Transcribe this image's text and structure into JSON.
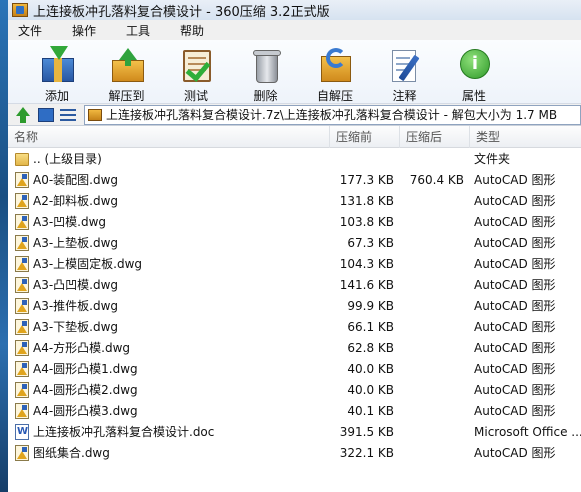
{
  "window": {
    "title": "上连接板冲孔落料复合模设计 - 360压缩 3.2正式版"
  },
  "menu": [
    "文件",
    "操作",
    "工具",
    "帮助"
  ],
  "toolbar": [
    {
      "label": "添加",
      "icon": "add-archive-icon"
    },
    {
      "label": "解压到",
      "icon": "extract-to-icon"
    },
    {
      "label": "测试",
      "icon": "test-icon"
    },
    {
      "label": "删除",
      "icon": "delete-icon"
    },
    {
      "label": "自解压",
      "icon": "self-extract-icon"
    },
    {
      "label": "注释",
      "icon": "comment-icon"
    },
    {
      "label": "属性",
      "icon": "properties-icon"
    }
  ],
  "address": {
    "path": "上连接板冲孔落料复合模设计.7z\\上连接板冲孔落料复合模设计 - 解包大小为 1.7 MB"
  },
  "columns": {
    "name": "名称",
    "size": "压缩前",
    "packed": "压缩后",
    "type": "类型"
  },
  "files": [
    {
      "name": ".. (上级目录)",
      "size": "",
      "packed": "",
      "type": "文件夹",
      "icon": "folder-icon"
    },
    {
      "name": "A0-装配图.dwg",
      "size": "177.3 KB",
      "packed": "760.4 KB",
      "type": "AutoCAD 图形",
      "icon": "dwg-icon"
    },
    {
      "name": "A2-卸料板.dwg",
      "size": "131.8 KB",
      "packed": "",
      "type": "AutoCAD 图形",
      "icon": "dwg-icon"
    },
    {
      "name": "A3-凹模.dwg",
      "size": "103.8 KB",
      "packed": "",
      "type": "AutoCAD 图形",
      "icon": "dwg-icon"
    },
    {
      "name": "A3-上垫板.dwg",
      "size": "67.3 KB",
      "packed": "",
      "type": "AutoCAD 图形",
      "icon": "dwg-icon"
    },
    {
      "name": "A3-上模固定板.dwg",
      "size": "104.3 KB",
      "packed": "",
      "type": "AutoCAD 图形",
      "icon": "dwg-icon"
    },
    {
      "name": "A3-凸凹模.dwg",
      "size": "141.6 KB",
      "packed": "",
      "type": "AutoCAD 图形",
      "icon": "dwg-icon"
    },
    {
      "name": "A3-推件板.dwg",
      "size": "99.9 KB",
      "packed": "",
      "type": "AutoCAD 图形",
      "icon": "dwg-icon"
    },
    {
      "name": "A3-下垫板.dwg",
      "size": "66.1 KB",
      "packed": "",
      "type": "AutoCAD 图形",
      "icon": "dwg-icon"
    },
    {
      "name": "A4-方形凸模.dwg",
      "size": "62.8 KB",
      "packed": "",
      "type": "AutoCAD 图形",
      "icon": "dwg-icon"
    },
    {
      "name": "A4-圆形凸模1.dwg",
      "size": "40.0 KB",
      "packed": "",
      "type": "AutoCAD 图形",
      "icon": "dwg-icon"
    },
    {
      "name": "A4-圆形凸模2.dwg",
      "size": "40.0 KB",
      "packed": "",
      "type": "AutoCAD 图形",
      "icon": "dwg-icon"
    },
    {
      "name": "A4-圆形凸模3.dwg",
      "size": "40.1 KB",
      "packed": "",
      "type": "AutoCAD 图形",
      "icon": "dwg-icon"
    },
    {
      "name": "上连接板冲孔落料复合模设计.doc",
      "size": "391.5 KB",
      "packed": "",
      "type": "Microsoft Office ...",
      "icon": "doc-icon"
    },
    {
      "name": "图纸集合.dwg",
      "size": "322.1 KB",
      "packed": "",
      "type": "AutoCAD 图形",
      "icon": "dwg-icon"
    }
  ]
}
